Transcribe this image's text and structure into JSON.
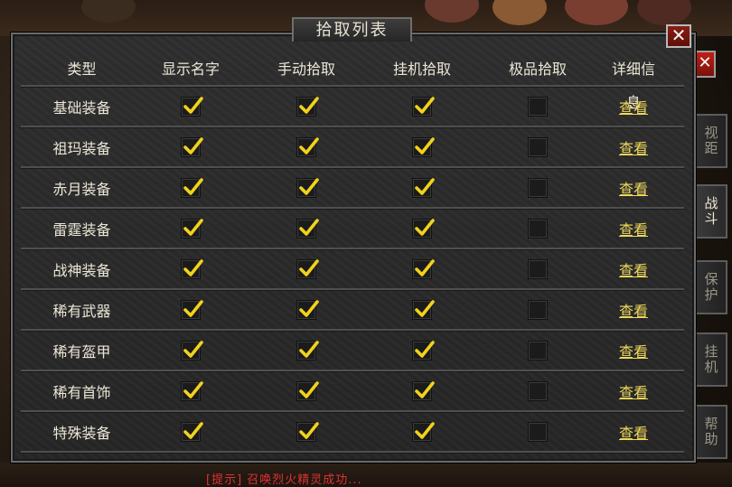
{
  "window": {
    "title": "拾取列表",
    "close_label": "✕"
  },
  "table": {
    "headers": [
      "类型",
      "显示名字",
      "手动拾取",
      "挂机拾取",
      "极品拾取",
      "详细信息"
    ],
    "rows": [
      {
        "type": "基础装备",
        "show_name": true,
        "manual_pickup": true,
        "auto_pickup": true,
        "premium_pickup": false,
        "detail": "查看"
      },
      {
        "type": "祖玛装备",
        "show_name": true,
        "manual_pickup": true,
        "auto_pickup": true,
        "premium_pickup": false,
        "detail": "查看"
      },
      {
        "type": "赤月装备",
        "show_name": true,
        "manual_pickup": true,
        "auto_pickup": true,
        "premium_pickup": false,
        "detail": "查看"
      },
      {
        "type": "雷霆装备",
        "show_name": true,
        "manual_pickup": true,
        "auto_pickup": true,
        "premium_pickup": false,
        "detail": "查看"
      },
      {
        "type": "战神装备",
        "show_name": true,
        "manual_pickup": true,
        "auto_pickup": true,
        "premium_pickup": false,
        "detail": "查看"
      },
      {
        "type": "稀有武器",
        "show_name": true,
        "manual_pickup": true,
        "auto_pickup": true,
        "premium_pickup": false,
        "detail": "查看"
      },
      {
        "type": "稀有盔甲",
        "show_name": true,
        "manual_pickup": true,
        "auto_pickup": true,
        "premium_pickup": false,
        "detail": "查看"
      },
      {
        "type": "稀有首饰",
        "show_name": true,
        "manual_pickup": true,
        "auto_pickup": true,
        "premium_pickup": false,
        "detail": "查看"
      },
      {
        "type": "特殊装备",
        "show_name": true,
        "manual_pickup": true,
        "auto_pickup": true,
        "premium_pickup": false,
        "detail": "查看"
      }
    ]
  },
  "side_tabs": [
    {
      "label": "视距",
      "active": false
    },
    {
      "label": "战斗",
      "active": true
    },
    {
      "label": "保护",
      "active": false
    },
    {
      "label": "挂机",
      "active": false
    },
    {
      "label": "帮助",
      "active": false
    }
  ],
  "background": {
    "notice": "[提示] 召唤烈火精灵成功..."
  },
  "colors": {
    "check": "#f2d21b",
    "link": "#eed85a",
    "text": "#ece6d6",
    "close": "#8a1e14"
  }
}
